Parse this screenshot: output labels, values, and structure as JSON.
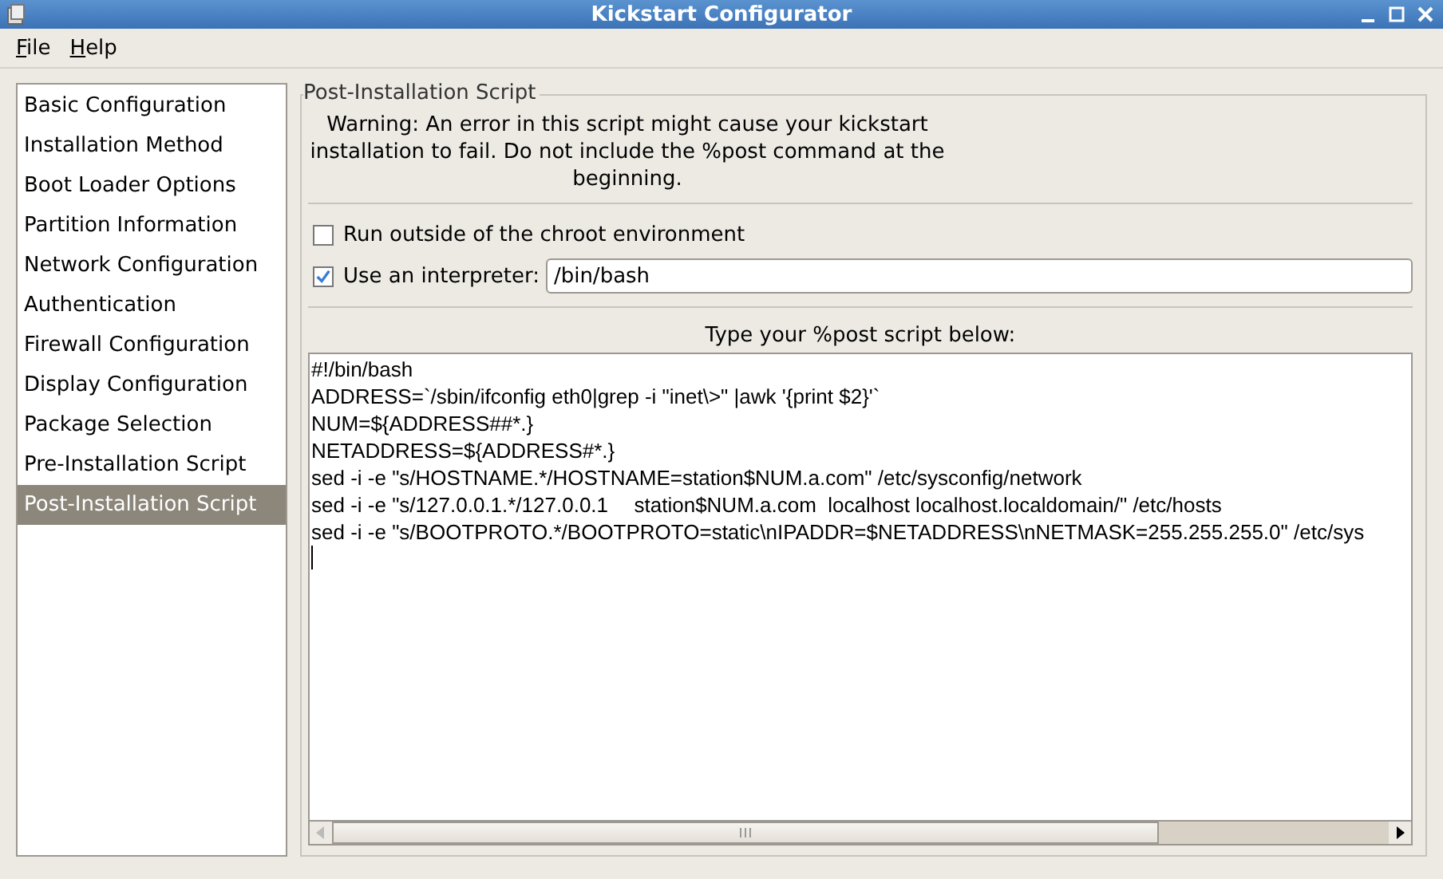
{
  "window": {
    "title": "Kickstart Configurator"
  },
  "menu": [
    {
      "label": "File"
    },
    {
      "label": "Help"
    }
  ],
  "sidebar": {
    "items": [
      {
        "label": "Basic Configuration",
        "selected": false
      },
      {
        "label": "Installation Method",
        "selected": false
      },
      {
        "label": "Boot Loader Options",
        "selected": false
      },
      {
        "label": "Partition Information",
        "selected": false
      },
      {
        "label": "Network Configuration",
        "selected": false
      },
      {
        "label": "Authentication",
        "selected": false
      },
      {
        "label": "Firewall Configuration",
        "selected": false
      },
      {
        "label": "Display Configuration",
        "selected": false
      },
      {
        "label": "Package Selection",
        "selected": false
      },
      {
        "label": "Pre-Installation Script",
        "selected": false
      },
      {
        "label": "Post-Installation Script",
        "selected": true
      }
    ]
  },
  "panel": {
    "title": "Post-Installation Script",
    "warning": "Warning: An error in this script might cause your kickstart installation to fail. Do not include the %post command at the beginning.",
    "chroot_option": {
      "label": "Run outside of the chroot environment",
      "checked": false
    },
    "interpreter_option": {
      "label": "Use an interpreter:",
      "checked": true,
      "value": "/bin/bash"
    },
    "script_label": "Type your %post script below:",
    "script_lines": [
      "#!/bin/bash",
      "ADDRESS=`/sbin/ifconfig eth0|grep -i \"inet\\>\" |awk '{print $2}'`",
      "NUM=${ADDRESS##*.}",
      "NETADDRESS=${ADDRESS#*.}",
      "sed -i -e \"s/HOSTNAME.*/HOSTNAME=station$NUM.a.com\" /etc/sysconfig/network",
      "sed -i -e \"s/127.0.0.1.*/127.0.0.1\tstation$NUM.a.com  localhost localhost.localdomain/\" /etc/hosts",
      "sed -i -e \"s/BOOTPROTO.*/BOOTPROTO=static\\nIPADDR=$NETADDRESS\\nNETMASK=255.255.255.0\" /etc/sys"
    ]
  }
}
